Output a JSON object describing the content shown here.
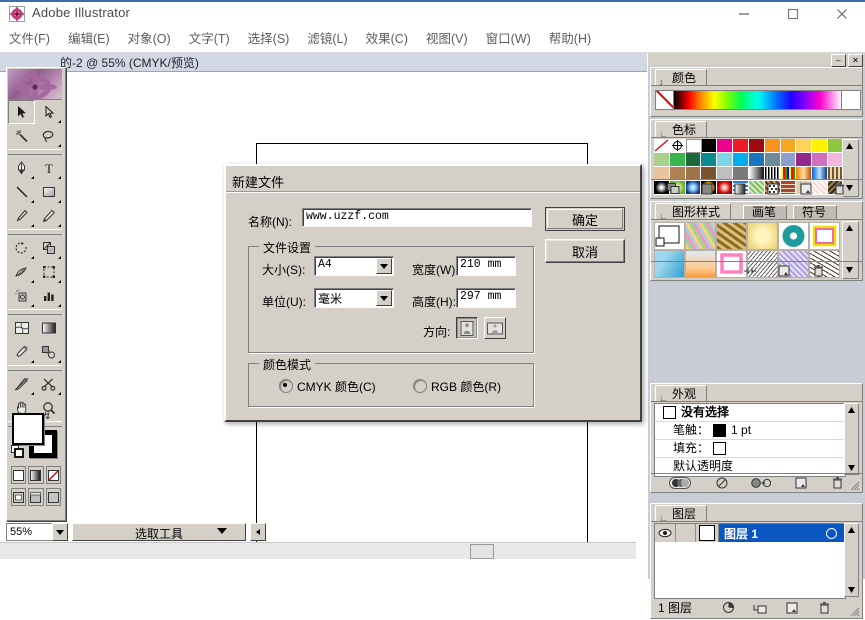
{
  "window": {
    "app_title": "Adobe Illustrator",
    "icon": "illustrator-flower-icon",
    "minimize": "—",
    "maximize": "□",
    "close": "✕"
  },
  "menubar": {
    "items": [
      {
        "label": "文件(F)"
      },
      {
        "label": "编辑(E)"
      },
      {
        "label": "对象(O)"
      },
      {
        "label": "文字(T)"
      },
      {
        "label": "选择(S)"
      },
      {
        "label": "滤镜(L)"
      },
      {
        "label": "效果(C)"
      },
      {
        "label": "视图(V)"
      },
      {
        "label": "窗口(W)"
      },
      {
        "label": "帮助(H)"
      }
    ]
  },
  "document": {
    "title": "的-2 @ 55% (CMYK/预览)"
  },
  "toolbox": {
    "tools": [
      [
        "selection-tool",
        "direct-selection-tool"
      ],
      [
        "magic-wand-tool",
        "lasso-tool"
      ],
      [
        "pen-tool",
        "type-tool"
      ],
      [
        "line-segment-tool",
        "rectangle-tool"
      ],
      [
        "paintbrush-tool",
        "pencil-tool"
      ],
      [
        "rotate-tool",
        "scale-tool"
      ],
      [
        "warp-tool",
        "free-transform-tool"
      ],
      [
        "symbol-sprayer-tool",
        "column-graph-tool"
      ],
      [
        "mesh-tool",
        "gradient-tool"
      ],
      [
        "eyedropper-tool",
        "blend-tool"
      ],
      [
        "slice-tool",
        "scissors-tool"
      ],
      [
        "hand-tool",
        "zoom-tool"
      ]
    ]
  },
  "statusbar": {
    "zoom_value": "55%",
    "tool_label": "选取工具"
  },
  "palettes": {
    "color": {
      "tab": "颜色"
    },
    "swatches": {
      "tab": "色标",
      "rows": [
        [
          "none",
          "registration",
          "#ffffff",
          "#000000",
          "#ec008c",
          "#ed1c24",
          "#9e0b0f",
          "#f7941d",
          "#f5a623",
          "#fdd35c",
          "#fff200",
          "#8dc63f"
        ],
        [
          "#a9d18e",
          "#39b54a",
          "#1b6b3a",
          "#0b8a8f",
          "#7fd4e8",
          "#00aeef",
          "#1b75bc",
          "#6d8a96",
          "#8c9fd1",
          "#92278f",
          "#cf6fbd",
          "#f4b6dd"
        ],
        [
          "#e8c39e",
          "#b08050",
          "#a0744a",
          "#7a5230",
          "#bfbfbf",
          "#7a7a7a",
          "gradient-bw",
          "stripes-bw",
          "rainbow-stripes",
          "gradient-orange",
          "gradient-blue",
          "brown-stripes"
        ],
        [
          "radial-black",
          "green-dot",
          "blue-square",
          "gold-ring",
          "red-kaleidoscope",
          "blue-lines",
          "green-texture",
          "brown-weave",
          "brick-pattern",
          "tile-pattern",
          "pink-dots",
          "dark-weave"
        ]
      ]
    },
    "styles": {
      "tabs": [
        "图形样式",
        "画笔",
        "符号"
      ],
      "active_tab": "图形样式",
      "cells": [
        [
          "default-style",
          "confetti-style",
          "gold-braid-style",
          "yellow-soft-style",
          "teal-donut-style",
          "yellow-pink-outline-style"
        ],
        [
          "blue-brush-style",
          "orange-gradient-style",
          "pink-frame-style",
          "scribble-style",
          "purple-hatch-style",
          "dark-scribble-style"
        ]
      ]
    },
    "appearance": {
      "tab": "外观",
      "title": "没有选择",
      "rows": [
        {
          "label": "笔触：",
          "value": "1 pt",
          "swatch": "#000000"
        },
        {
          "label": "填充：",
          "value": "",
          "swatch": "#ffffff"
        },
        {
          "label": "默认透明度",
          "value": "",
          "swatch": null
        }
      ]
    },
    "layers": {
      "tab": "图层",
      "rows": [
        {
          "name": "图层 1",
          "visible": true,
          "selected": true
        }
      ],
      "footer_count": "1 图层"
    }
  },
  "dialog": {
    "title": "新建文件",
    "name_label": "名称(N):",
    "name_value": "www.uzzf.com",
    "ok_button": "确定",
    "cancel_button": "取消",
    "file_settings": {
      "caption": "文件设置",
      "size_label": "大小(S):",
      "size_value": "A4",
      "width_label": "宽度(W):",
      "width_value": "210 mm",
      "units_label": "单位(U):",
      "units_value": "毫米",
      "height_label": "高度(H):",
      "height_value": "297 mm",
      "orientation_label": "方向:",
      "orientation_portrait": "portrait-orientation",
      "orientation_landscape": "landscape-orientation",
      "orientation_selected": "portrait"
    },
    "color_mode": {
      "caption": "颜色模式",
      "cmyk_label": "CMYK 颜色(C)",
      "rgb_label": "RGB 颜色(R)",
      "selected": "CMYK"
    }
  },
  "colors": {
    "chrome": "#d4d0c8",
    "dock_bg": "#c8ccd4",
    "titlebar": "#ffffff",
    "accent": "#3b6ea5",
    "layer_selected": "#0a57c2",
    "doc_titlebar": "#d3d9e4"
  }
}
